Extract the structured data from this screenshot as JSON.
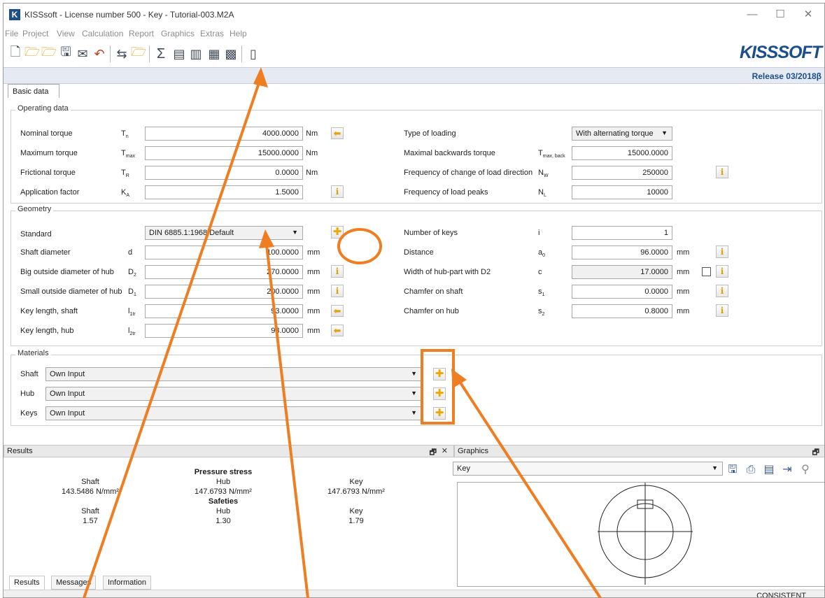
{
  "window": {
    "app_logo": "K",
    "title": "KISSsoft - License number 500 - Key - Tutorial-003.M2A",
    "controls": [
      "—",
      "☐",
      "✕"
    ]
  },
  "menu": [
    "File",
    "Project",
    "View",
    "Calculation",
    "Report",
    "Graphics",
    "Extras",
    "Help"
  ],
  "toolbar_icons": [
    "new-file-icon",
    "open-folder-icon",
    "open-example-icon",
    "save-icon",
    "email-icon",
    "undo-icon",
    "import-icon",
    "export-folder-icon",
    "calculate-sum-icon",
    "report-icon",
    "report-view-icon",
    "database-icon",
    "calculator-icon",
    "module-specific-icon"
  ],
  "brand": {
    "logo_text": "KISSSOFT",
    "release": "Release 03/2018β",
    "color": "#1c4e8c"
  },
  "tabs": {
    "basic": "Basic data"
  },
  "operating": {
    "title": "Operating data",
    "rows": [
      {
        "label": "Nominal torque",
        "sym": "T",
        "sub": "n",
        "value": "4000.0000",
        "unit": "Nm"
      },
      {
        "label": "Maximum torque",
        "sym": "T",
        "sub": "max",
        "value": "15000.0000",
        "unit": "Nm"
      },
      {
        "label": "Frictional torque",
        "sym": "T",
        "sub": "R",
        "value": "0.0000",
        "unit": "Nm"
      },
      {
        "label": "Application factor",
        "sym": "K",
        "sub": "A",
        "value": "1.5000",
        "unit": ""
      }
    ],
    "right_rows": [
      {
        "label": "Type of loading",
        "sym": "",
        "sub": "",
        "value": "With alternating torque"
      },
      {
        "label": "Maximal backwards torque",
        "sym": "T",
        "sub": "max, back",
        "value": "15000.0000"
      },
      {
        "label": "Frequency of change of load direction",
        "sym": "N",
        "sub": "W",
        "value": "250000"
      },
      {
        "label": "Frequency of load peaks",
        "sym": "N",
        "sub": "L",
        "value": "10000"
      }
    ]
  },
  "geometry": {
    "title": "Geometry",
    "standard_label": "Standard",
    "standard_value": "DIN 6885.1:1968 Default",
    "rows": [
      {
        "label": "Shaft diameter",
        "sym": "d",
        "sub": "",
        "value": "100.0000",
        "unit": "mm"
      },
      {
        "label": "Big outside diameter of hub",
        "sym": "D",
        "sub": "2",
        "value": "270.0000",
        "unit": "mm"
      },
      {
        "label": "Small outside diameter of hub",
        "sym": "D",
        "sub": "1",
        "value": "200.0000",
        "unit": "mm"
      },
      {
        "label": "Key length, shaft",
        "sym": "l",
        "sub": "1tr",
        "value": "93.0000",
        "unit": "mm"
      },
      {
        "label": "Key length, hub",
        "sym": "l",
        "sub": "2tr",
        "value": "93.0000",
        "unit": "mm"
      }
    ],
    "right_rows": [
      {
        "label": "Number of keys",
        "sym": "i",
        "sub": "",
        "value": "1",
        "unit": ""
      },
      {
        "label": "Distance",
        "sym": "a",
        "sub": "0",
        "value": "96.0000",
        "unit": "mm"
      },
      {
        "label": "Width of hub-part with D2",
        "sym": "c",
        "sub": "",
        "value": "17.0000",
        "unit": "mm"
      },
      {
        "label": "Chamfer on shaft",
        "sym": "s",
        "sub": "1",
        "value": "0.0000",
        "unit": "mm"
      },
      {
        "label": "Chamfer on hub",
        "sym": "s",
        "sub": "2",
        "value": "0.8000",
        "unit": "mm"
      }
    ]
  },
  "materials": {
    "title": "Materials",
    "rows": [
      {
        "label": "Shaft",
        "value": "Own Input"
      },
      {
        "label": "Hub",
        "value": "Own Input"
      },
      {
        "label": "Keys",
        "value": "Own Input"
      }
    ]
  },
  "results": {
    "panel_title": "Results",
    "pressure_title": "Pressure stress",
    "safeties_title": "Safeties",
    "cols": [
      "Shaft",
      "Hub",
      "Key"
    ],
    "pressure": [
      "143.5486 N/mm²",
      "147.6793 N/mm²",
      "147.6793 N/mm²"
    ],
    "safeties": [
      "1.57",
      "1.30",
      "1.79"
    ],
    "tabs": [
      "Results",
      "Messages",
      "Information"
    ]
  },
  "graphics": {
    "panel_title": "Graphics",
    "view_value": "Key",
    "icons": [
      "save-graphic-icon",
      "print-icon",
      "export-icon",
      "import-icon",
      "properties-icon"
    ]
  },
  "panel_controls": {
    "float": "🗗",
    "close": "✕"
  },
  "status": {
    "text": "CONSISTENT"
  },
  "annotation_color": "#ef7d22"
}
